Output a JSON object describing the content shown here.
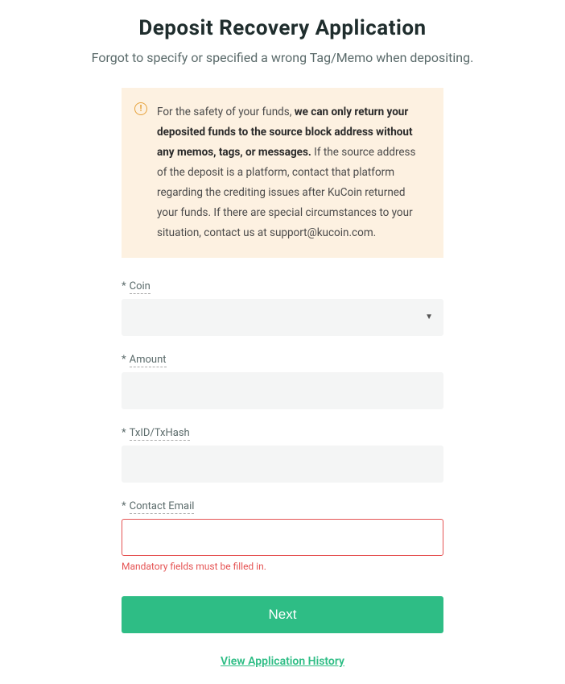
{
  "header": {
    "title": "Deposit Recovery Application",
    "subtitle": "Forgot to specify or specified a wrong Tag/Memo when depositing."
  },
  "notice": {
    "prefix": "For the safety of your funds, ",
    "bold": "we can only return your deposited funds to the source block address without any memos, tags, or messages.",
    "suffix": " If the source address of the deposit is a platform, contact that platform regarding the crediting issues after KuCoin returned your funds. If there are special circumstances to your situation, contact us at support@kucoin.com."
  },
  "form": {
    "required_mark": "*",
    "coin": {
      "label": "Coin",
      "value": ""
    },
    "amount": {
      "label": "Amount",
      "value": ""
    },
    "txid": {
      "label": "TxID/TxHash",
      "value": ""
    },
    "email": {
      "label": "Contact Email",
      "value": "",
      "error": "Mandatory fields must be filled in."
    },
    "submit_label": "Next"
  },
  "footer": {
    "history_link": "View Application History"
  }
}
